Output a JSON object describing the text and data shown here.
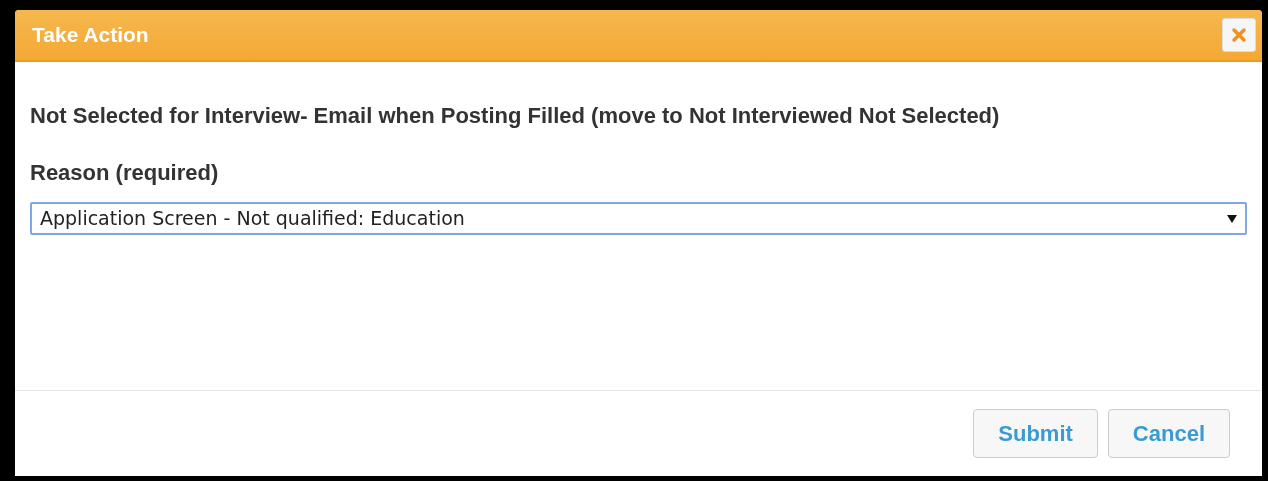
{
  "dialog": {
    "title": "Take Action",
    "heading": "Not Selected for Interview- Email when Posting Filled (move to Not Interviewed Not Selected)",
    "reason_label": "Reason (required)",
    "reason_value": "Application Screen - Not qualified: Education",
    "buttons": [
      "Submit",
      "Cancel"
    ]
  }
}
